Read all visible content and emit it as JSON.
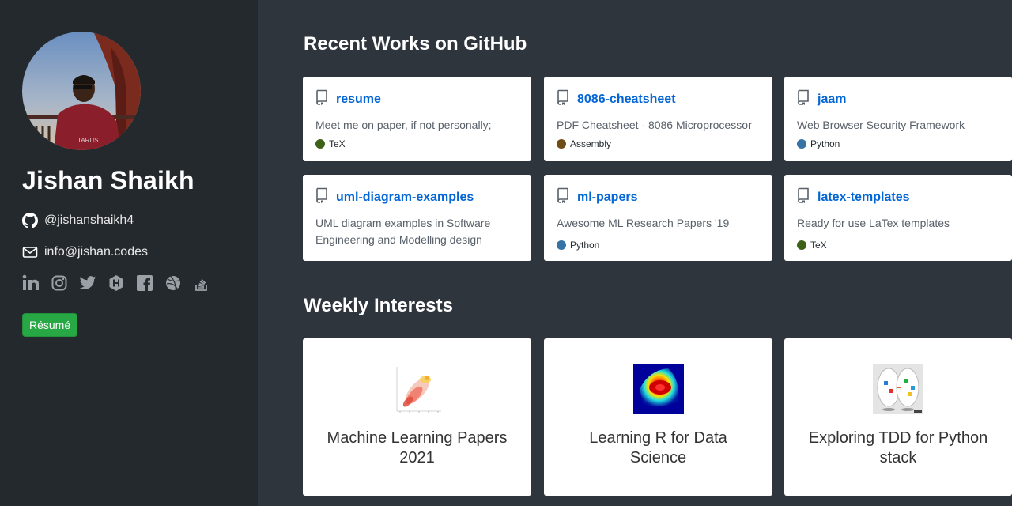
{
  "profile": {
    "name": "Jishan Shaikh",
    "github_handle": "@jishanshaikh4",
    "email": "info@jishan.codes",
    "social_icons": [
      "linkedin-icon",
      "instagram-icon",
      "twitter-icon",
      "hackerrank-icon",
      "facebook-icon",
      "dribbble-icon",
      "stackoverflow-icon"
    ],
    "resume_label": "Résumé"
  },
  "sections": {
    "github_title": "Recent Works on GitHub",
    "interests_title": "Weekly Interests"
  },
  "repos": [
    {
      "name": "resume",
      "description": "Meet me on paper, if not personally;",
      "language": "TeX",
      "lang_color": "#3d6117"
    },
    {
      "name": "8086-cheatsheet",
      "description": "PDF Cheatsheet - 8086 Microprocessor",
      "language": "Assembly",
      "lang_color": "#6e4c13"
    },
    {
      "name": "jaam",
      "description": "Web Browser Security Framework",
      "language": "Python",
      "lang_color": "#3572A5"
    },
    {
      "name": "uml-diagram-examples",
      "description": "UML diagram examples in Software Engineering and Modelling design",
      "language": "",
      "lang_color": ""
    },
    {
      "name": "ml-papers",
      "description": "Awesome ML Research Papers '19",
      "language": "Python",
      "lang_color": "#3572A5"
    },
    {
      "name": "latex-templates",
      "description": "Ready for use LaTex templates",
      "language": "TeX",
      "lang_color": "#3d6117"
    }
  ],
  "interests": [
    {
      "title": "Machine Learning Papers 2021",
      "image": "scatter-plot-thumbnail"
    },
    {
      "title": "Learning R for Data Science",
      "image": "heatmap-thumbnail"
    },
    {
      "title": "Exploring TDD for Python stack",
      "image": "tdd-diagram-thumbnail"
    }
  ],
  "colors": {
    "sidebar_bg": "#24292e",
    "main_bg": "#2f353d",
    "link_blue": "#0366d6",
    "resume_green": "#28a745"
  }
}
